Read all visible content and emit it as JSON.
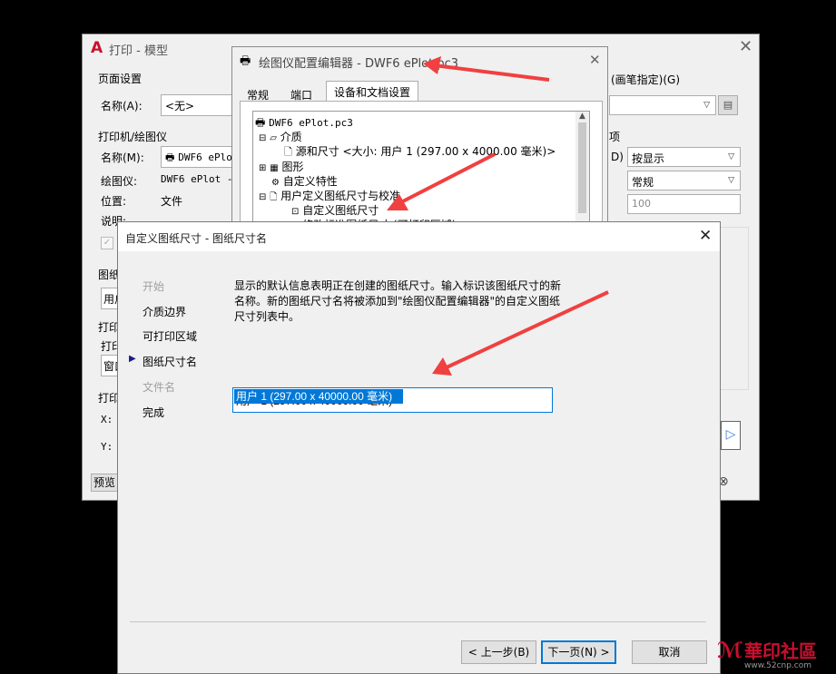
{
  "print_dialog": {
    "title": "打印 - 模型",
    "page_setup_group": "页面设置",
    "name_label": "名称(A):",
    "name_value": "<无>",
    "printer_group": "打印机/绘图仪",
    "printer_name_label": "名称(M):",
    "printer_name_value": "DWF6 ePlot.pc3",
    "plotter_label": "绘图仪:",
    "plotter_value": "DWF6 ePlot - ",
    "location_label": "位置:",
    "location_value": "文件",
    "description_label": "说明:",
    "paper_size_label": "图纸",
    "paper_size_value": "用户",
    "plot_area_label": "打印",
    "plot_area_sub": "打印",
    "plot_area_value": "窗口",
    "offset_label": "打印",
    "x_label": "X:",
    "y_label": "Y:",
    "preview_button": "预览",
    "plot_style_label": "(画笔指定)(G)",
    "options_label": "项",
    "shade_suffix": "D)",
    "shade_value": "按显示",
    "quality_value": "常规",
    "dpi_value": "100"
  },
  "editor_dialog": {
    "title": "绘图仪配置编辑器 - DWF6 ePlot.pc3",
    "tabs": [
      "常规",
      "端口",
      "设备和文档设置"
    ],
    "tree": [
      {
        "text": "DWF6 ePlot.pc3"
      },
      {
        "text": "介质"
      },
      {
        "text": "源和尺寸 <大小: 用户 1 (297.00 x 4000.00 毫米)>"
      },
      {
        "text": "图形"
      },
      {
        "text": "自定义特性"
      },
      {
        "text": "用户定义图纸尺寸与校准"
      },
      {
        "text": "自定义图纸尺寸"
      },
      {
        "text": "修改标准图纸尺寸 (可打印区域)"
      }
    ]
  },
  "wizard": {
    "title": "自定义图纸尺寸 - 图纸尺寸名",
    "steps": [
      {
        "label": "开始",
        "disabled": true
      },
      {
        "label": "介质边界",
        "disabled": false
      },
      {
        "label": "可打印区域",
        "disabled": false
      },
      {
        "label": "图纸尺寸名",
        "disabled": false
      },
      {
        "label": "文件名",
        "disabled": true
      },
      {
        "label": "完成",
        "disabled": false
      }
    ],
    "description": "显示的默认信息表明正在创建的图纸尺寸。输入标识该图纸尺寸的新名称。新的图纸尺寸名将被添加到\"绘图仪配置编辑器\"的自定义图纸尺寸列表中。",
    "name_input_value": "用户 1 (297.00 x 40000.00 毫米)",
    "back_button": "< 上一步(B)",
    "next_button": "下一页(N) >",
    "cancel_button": "取消"
  },
  "watermark": {
    "text": "華印社區",
    "url": "www.52cnp.com"
  },
  "colors": {
    "arrow": "#f04040",
    "accent": "#0078d7",
    "selection": "#0078d7"
  }
}
